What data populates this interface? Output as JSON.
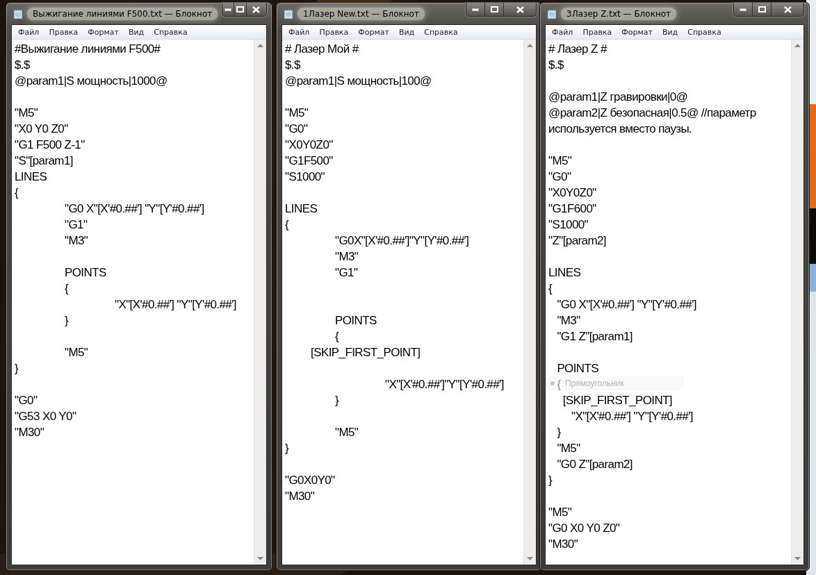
{
  "windows": [
    {
      "title": "Выжигание линиями F500.txt — Блокнот",
      "menu": [
        "Файл",
        "Правка",
        "Формат",
        "Вид",
        "Справка"
      ],
      "lines": [
        {
          "kind": "code",
          "text": "#Выжигание линиями F500#"
        },
        {
          "kind": "code",
          "text": "$.$"
        },
        {
          "kind": "code",
          "text": "@param1|S мощность|1000@"
        },
        {
          "kind": "blank"
        },
        {
          "kind": "code",
          "text": "\"M5\""
        },
        {
          "kind": "code",
          "text": "\"X0 Y0 Z0\""
        },
        {
          "kind": "code",
          "text": "\"G1 F500 Z-1\""
        },
        {
          "kind": "code",
          "text": "\"S\"[param1]"
        },
        {
          "kind": "code",
          "text": "LINES"
        },
        {
          "kind": "code",
          "text": "{"
        },
        {
          "kind": "code",
          "text": "\t\"G0 X\"[X'#0.##'] \"Y\"[Y'#0.##']"
        },
        {
          "kind": "code",
          "text": "\t\"G1\""
        },
        {
          "kind": "code",
          "text": "\t\"M3\""
        },
        {
          "kind": "blank"
        },
        {
          "kind": "code",
          "text": "\tPOINTS"
        },
        {
          "kind": "code",
          "text": "\t{"
        },
        {
          "kind": "code",
          "text": "\t\t\"X\"[X'#0.##'] \"Y\"[Y'#0.##']"
        },
        {
          "kind": "code",
          "text": "\t}"
        },
        {
          "kind": "blank"
        },
        {
          "kind": "code",
          "text": "\t\"M5\""
        },
        {
          "kind": "code",
          "text": "}"
        },
        {
          "kind": "blank"
        },
        {
          "kind": "code",
          "text": "\"G0\""
        },
        {
          "kind": "code",
          "text": "\"G53 X0 Y0\""
        },
        {
          "kind": "code",
          "text": "\"M30\""
        }
      ]
    },
    {
      "title": "1Лазер New.txt — Блокнот",
      "menu": [
        "Файл",
        "Правка",
        "Формат",
        "Вид",
        "Справка"
      ],
      "lines": [
        {
          "kind": "code",
          "text": "# Лазер Мой #"
        },
        {
          "kind": "code",
          "text": "$.$"
        },
        {
          "kind": "code",
          "text": "@param1|S мощность|100@"
        },
        {
          "kind": "blank"
        },
        {
          "kind": "code",
          "text": "\"M5\""
        },
        {
          "kind": "code",
          "text": "\"G0\""
        },
        {
          "kind": "code",
          "text": "\"X0Y0Z0\""
        },
        {
          "kind": "code",
          "text": "\"G1F500\""
        },
        {
          "kind": "code",
          "text": "\"S1000\""
        },
        {
          "kind": "blank"
        },
        {
          "kind": "code",
          "text": "LINES"
        },
        {
          "kind": "code",
          "text": "{"
        },
        {
          "kind": "code",
          "text": "\t\"G0X\"[X'#0.##']\"Y\"[Y'#0.##']"
        },
        {
          "kind": "code",
          "text": "\t\"M3\""
        },
        {
          "kind": "code",
          "text": "\t\"G1\""
        },
        {
          "kind": "blank"
        },
        {
          "kind": "blank"
        },
        {
          "kind": "code",
          "text": "\tPOINTS"
        },
        {
          "kind": "code",
          "text": "\t{"
        },
        {
          "kind": "code",
          "text": "         [SKIP_FIRST_POINT]"
        },
        {
          "kind": "blank"
        },
        {
          "kind": "code",
          "text": "\t\t\"X\"[X'#0.##']\"Y\"[Y'#0.##']"
        },
        {
          "kind": "code",
          "text": "\t}"
        },
        {
          "kind": "blank"
        },
        {
          "kind": "code",
          "text": "\t\"M5\""
        },
        {
          "kind": "code",
          "text": "}"
        },
        {
          "kind": "blank"
        },
        {
          "kind": "code",
          "text": "\"G0X0Y0\""
        },
        {
          "kind": "code",
          "text": "\"M30\""
        }
      ]
    },
    {
      "title": "3Лазер Z.txt — Блокнот",
      "menu": [
        "Файл",
        "Правка",
        "Формат",
        "Вид",
        "Справка"
      ],
      "lines": [
        {
          "kind": "code",
          "text": "# Лазер Z #"
        },
        {
          "kind": "code",
          "text": "$.$"
        },
        {
          "kind": "blank"
        },
        {
          "kind": "code",
          "text": "@param1|Z гравировки|0@"
        },
        {
          "kind": "code",
          "text": "@param2|Z безопасная|0.5@ //параметр"
        },
        {
          "kind": "code",
          "text": "используется вместо паузы."
        },
        {
          "kind": "blank"
        },
        {
          "kind": "code",
          "text": "\"M5\""
        },
        {
          "kind": "code",
          "text": "\"G0\""
        },
        {
          "kind": "code",
          "text": "\"X0Y0Z0\""
        },
        {
          "kind": "code",
          "text": "\"G1F600\""
        },
        {
          "kind": "code",
          "text": "\"S1000\""
        },
        {
          "kind": "code",
          "text": "\"Z\"[param2]"
        },
        {
          "kind": "blank"
        },
        {
          "kind": "code",
          "text": "LINES"
        },
        {
          "kind": "code",
          "text": "{"
        },
        {
          "kind": "code",
          "text": "   \"G0 X\"[X'#0.##'] \"Y\"[Y'#0.##']"
        },
        {
          "kind": "code",
          "text": "   \"M3\""
        },
        {
          "kind": "code",
          "text": "   \"G1 Z\"[param1]"
        },
        {
          "kind": "blank"
        },
        {
          "kind": "code",
          "text": "   POINTS"
        },
        {
          "kind": "code",
          "text": "   {"
        },
        {
          "kind": "code",
          "text": "     [SKIP_FIRST_POINT]"
        },
        {
          "kind": "code",
          "text": "        \"X\"[X'#0.##'] \"Y\"[Y'#0.##']"
        },
        {
          "kind": "code",
          "text": "   }"
        },
        {
          "kind": "code",
          "text": "   \"M5\""
        },
        {
          "kind": "code",
          "text": "   \"G0 Z\"[param2]"
        },
        {
          "kind": "code",
          "text": "}"
        },
        {
          "kind": "blank"
        },
        {
          "kind": "code",
          "text": "\"M5\""
        },
        {
          "kind": "code",
          "text": "\"G0 X0 Y0 Z0\""
        },
        {
          "kind": "code",
          "text": "\"M30\""
        }
      ],
      "ghost_tooltip": "Прямоугольник"
    }
  ]
}
